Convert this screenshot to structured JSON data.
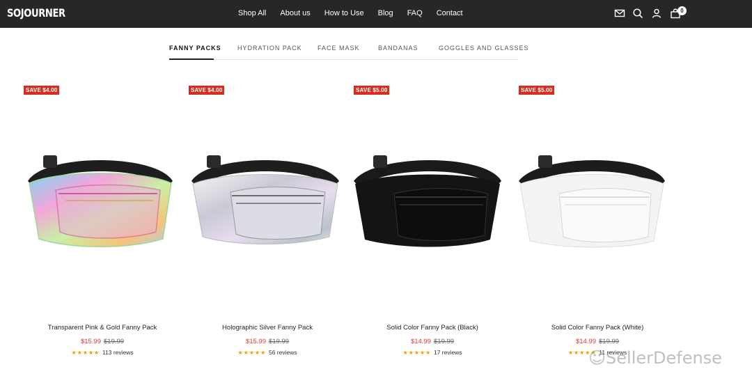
{
  "header": {
    "logo": "SOJOURNER",
    "nav": [
      "Shop All",
      "About us",
      "How to Use",
      "Blog",
      "FAQ",
      "Contact"
    ],
    "icons": [
      "mail-icon",
      "search-icon",
      "account-icon",
      "cart-icon"
    ],
    "cart_count": "0"
  },
  "tabs": [
    "FANNY PACKS",
    "HYDRATION PACK",
    "FACE MASK",
    "BANDANAS",
    "GOGGLES AND GLASSES"
  ],
  "active_tab": "FANNY PACKS",
  "colors": {
    "header_bg": "#272727",
    "sale_red": "#d62d20",
    "star": "#f0a500"
  },
  "products": [
    {
      "badge": "SAVE $4.00",
      "title": "Transparent Pink & Gold Fanny Pack",
      "sale_price": "$15.99",
      "original_price": "$19.99",
      "stars": "★★★★★",
      "reviews": "113 reviews"
    },
    {
      "badge": "SAVE $4.00",
      "title": "Holographic Silver Fanny Pack",
      "sale_price": "$15.99",
      "original_price": "$19.99",
      "stars": "★★★★★",
      "reviews": "56 reviews"
    },
    {
      "badge": "SAVE $5.00",
      "title": "Solid Color Fanny Pack (Black)",
      "sale_price": "$14.99",
      "original_price": "$19.99",
      "stars": "★★★★★",
      "reviews": "17 reviews"
    },
    {
      "badge": "SAVE $5.00",
      "title": "Solid Color Fanny Pack (White)",
      "sale_price": "$14.99",
      "original_price": "$19.99",
      "stars": "★★★★★",
      "reviews": "11 reviews"
    }
  ],
  "watermark": "SellerDefense"
}
